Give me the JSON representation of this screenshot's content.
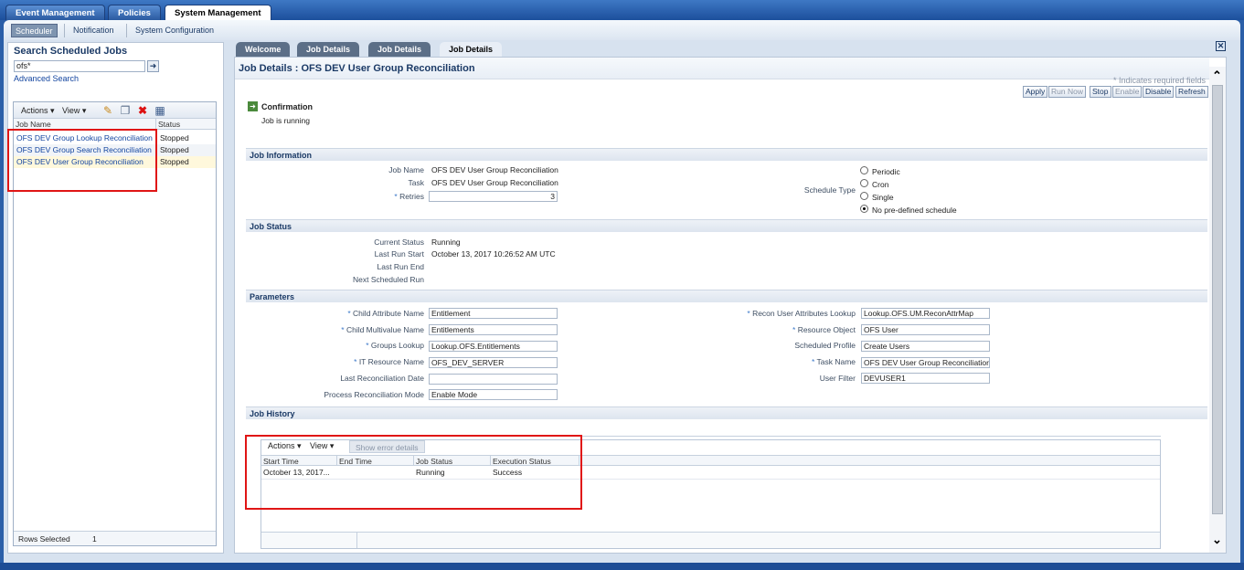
{
  "top_tabs": [
    {
      "label": "Event Management"
    },
    {
      "label": "Policies"
    },
    {
      "label": "System Management"
    }
  ],
  "subnav": [
    {
      "label": "Scheduler"
    },
    {
      "label": "Notification"
    },
    {
      "label": "System Configuration"
    }
  ],
  "left_panel": {
    "title": "Search Scheduled Jobs",
    "search_value": "ofs*",
    "advanced_search": "Advanced Search",
    "toolbar": {
      "actions": "Actions ▾",
      "view": "View ▾"
    },
    "columns": [
      "Job Name",
      "Status"
    ],
    "rows": [
      {
        "name": "OFS DEV Group Lookup Reconciliation",
        "status": "Stopped"
      },
      {
        "name": "OFS DEV Group Search Reconciliation",
        "status": "Stopped"
      },
      {
        "name": "OFS DEV User Group Reconciliation",
        "status": "Stopped"
      }
    ],
    "rows_selected_label": "Rows Selected",
    "rows_selected_count": "1"
  },
  "content_tabs": [
    {
      "label": "Welcome"
    },
    {
      "label": "Job Details"
    },
    {
      "label": "Job Details"
    },
    {
      "label": "Job Details"
    }
  ],
  "content": {
    "title": "Job Details : OFS DEV User Group Reconciliation",
    "required_note": "* Indicates required fields",
    "buttons": {
      "apply": "Apply",
      "run_now": "Run Now",
      "stop": "Stop",
      "enable": "Enable",
      "disable": "Disable",
      "refresh": "Refresh"
    },
    "confirmation": {
      "title": "Confirmation",
      "message": "Job is running"
    },
    "job_information": {
      "heading": "Job Information",
      "job_name_label": "Job Name",
      "job_name": "OFS DEV User Group Reconciliation",
      "task_label": "Task",
      "task": "OFS DEV User Group Reconciliation",
      "retries_label": "Retries",
      "retries": "3",
      "schedule_type_label": "Schedule Type",
      "schedule_options": [
        "Periodic",
        "Cron",
        "Single",
        "No pre-defined schedule"
      ],
      "selected_schedule": "No pre-defined schedule"
    },
    "job_status": {
      "heading": "Job Status",
      "current_status_label": "Current Status",
      "current_status": "Running",
      "last_run_start_label": "Last Run Start",
      "last_run_start": "October 13, 2017 10:26:52 AM UTC",
      "last_run_end_label": "Last Run End",
      "last_run_end": "",
      "next_run_label": "Next Scheduled Run",
      "next_run": ""
    },
    "parameters": {
      "heading": "Parameters",
      "child_attribute_name_label": "Child Attribute Name",
      "child_attribute_name": "Entitlement",
      "child_multivalue_name_label": "Child Multivalue Name",
      "child_multivalue_name": "Entitlements",
      "groups_lookup_label": "Groups Lookup",
      "groups_lookup": "Lookup.OFS.Entitlements",
      "it_resource_name_label": "IT Resource Name",
      "it_resource_name": "OFS_DEV_SERVER",
      "last_recon_date_label": "Last Reconciliation Date",
      "last_recon_date": "",
      "process_recon_mode_label": "Process Reconciliation Mode",
      "process_recon_mode": "Enable Mode",
      "recon_user_attr_lookup_label": "Recon User Attributes Lookup",
      "recon_user_attr_lookup": "Lookup.OFS.UM.ReconAttrMap",
      "resource_object_label": "Resource Object",
      "resource_object": "OFS User",
      "scheduled_profile_label": "Scheduled Profile",
      "scheduled_profile": "Create Users",
      "task_name_label": "Task Name",
      "task_name": "OFS DEV User Group Reconciliatior",
      "user_filter_label": "User Filter",
      "user_filter": "DEVUSER1"
    },
    "job_history": {
      "heading": "Job History",
      "actions": "Actions ▾",
      "view": "View ▾",
      "show_error_details": "Show error details",
      "columns": [
        "Start Time",
        "End Time",
        "Job Status",
        "Execution Status"
      ],
      "rows": [
        {
          "start": "October 13, 2017...",
          "end": "",
          "job_status": "Running",
          "execution_status": "Success"
        }
      ]
    }
  }
}
